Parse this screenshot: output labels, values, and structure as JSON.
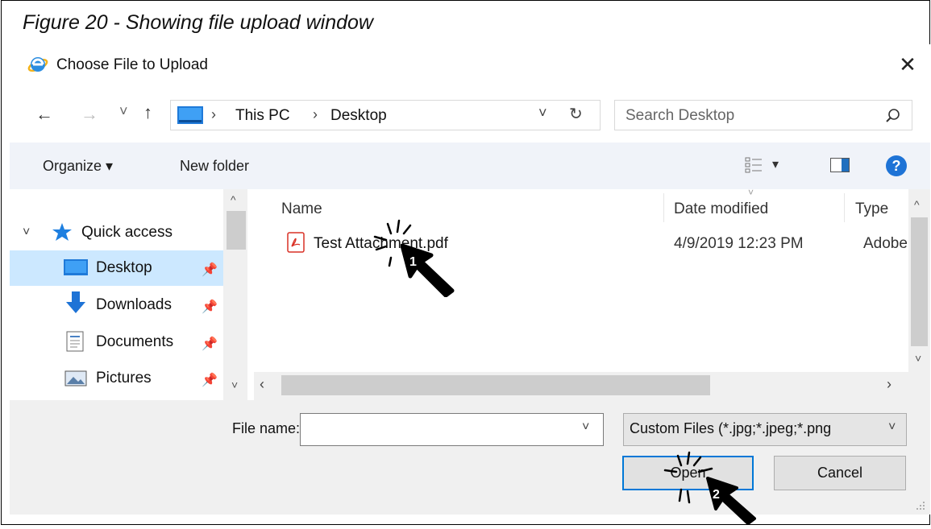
{
  "caption": "Figure 20 - Showing file upload window",
  "dialog": {
    "title": "Choose File to Upload",
    "close_glyph": "✕"
  },
  "nav": {
    "back_glyph": "←",
    "forward_glyph": "→",
    "recent_glyph": "˅",
    "up_glyph": "↑",
    "breadcrumb": [
      "This PC",
      "Desktop"
    ],
    "breadcrumb_sep": "›",
    "addr_dropdown_glyph": "˅",
    "refresh_glyph": "↻",
    "search_placeholder": "Search Desktop"
  },
  "toolbar": {
    "organize": "Organize ▾",
    "new_folder": "New folder",
    "view_dropdown_glyph": "▾",
    "help_glyph": "?"
  },
  "sidebar": {
    "quick_access": "Quick access",
    "items": [
      {
        "label": "Desktop",
        "selected": true
      },
      {
        "label": "Downloads",
        "selected": false
      },
      {
        "label": "Documents",
        "selected": false
      },
      {
        "label": "Pictures",
        "selected": false
      }
    ]
  },
  "files": {
    "columns": [
      "Name",
      "Date modified",
      "Type"
    ],
    "rows": [
      {
        "name": "Test Attachment.pdf",
        "date": "4/9/2019 12:23 PM",
        "type": "Adobe"
      }
    ]
  },
  "bottom": {
    "file_name_label": "File name:",
    "file_name_value": "",
    "filter_value": "Custom Files (*.jpg;*.jpeg;*.png",
    "open_label": "Open",
    "cancel_label": "Cancel"
  },
  "annotations": {
    "step1": "1",
    "step2": "2"
  },
  "colors": {
    "accent": "#0078d7",
    "selection": "#cce8ff",
    "pdf_red": "#d93025",
    "help_blue": "#1e73d6"
  },
  "icons": [
    "ie-logo-icon",
    "pc-icon",
    "search-icon",
    "quick-access-star-icon",
    "desktop-icon",
    "downloads-icon",
    "documents-icon",
    "pictures-icon",
    "pin-icon",
    "pdf-icon",
    "view-icon",
    "preview-pane-icon",
    "help-icon",
    "cursor-icon"
  ]
}
